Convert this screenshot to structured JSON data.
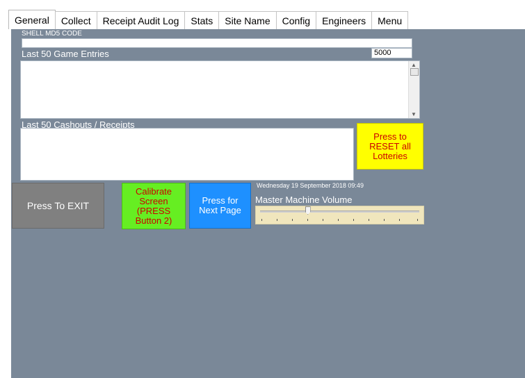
{
  "tabs": [
    {
      "label": "General",
      "active": true
    },
    {
      "label": "Collect"
    },
    {
      "label": "Receipt Audit Log"
    },
    {
      "label": "Stats"
    },
    {
      "label": "Site Name"
    },
    {
      "label": "Config"
    },
    {
      "label": "Engineers"
    },
    {
      "label": "Menu"
    }
  ],
  "md5": {
    "label": "SHELL MD5 CODE",
    "value": ""
  },
  "game_entries": {
    "label": "Last 50 Game Entries",
    "count_value": "5000",
    "content": ""
  },
  "cashouts": {
    "label": "Last 50 Cashouts / Receipts",
    "content": ""
  },
  "buttons": {
    "reset_lotteries": "Press to RESET all Lotteries",
    "exit": "Press To EXIT",
    "calibrate": "Calibrate Screen (PRESS Button 2)",
    "next_page": "Press for Next Page"
  },
  "datetime": "Wednesday 19 September 2018 09:49",
  "volume": {
    "label": "Master Machine Volume",
    "level": 0.3
  },
  "colors": {
    "panel": "#7a8898",
    "reset_button": "#ffff00",
    "reset_text": "#cc0000",
    "exit_button": "#808080",
    "calibrate_button": "#66ee22",
    "calibrate_text": "#cc0000",
    "next_page_button": "#1e90ff",
    "slider_bg": "#f0e6bd"
  }
}
